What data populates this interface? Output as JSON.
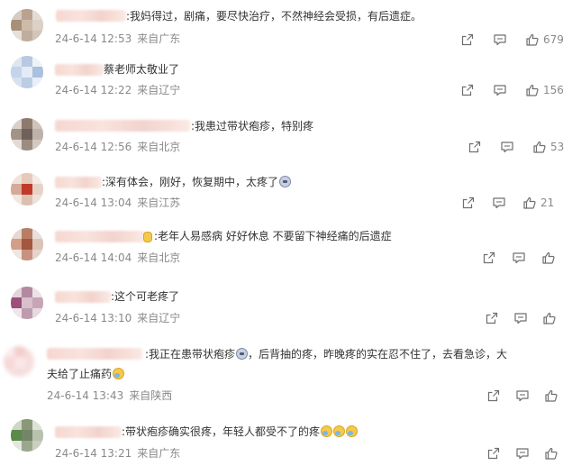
{
  "comments": [
    {
      "text_lines": [
        ":我妈得过，剧痛，要尽快治疗，不然神经会受损，有后遗症。"
      ],
      "time": "24-6-14 12:53",
      "location": "来自广东",
      "likes": "679"
    },
    {
      "text_lines": [
        "蔡老师太敬业了"
      ],
      "time": "24-6-14 12:22",
      "location": "来自辽宁",
      "likes": "156"
    },
    {
      "text_lines": [
        ":我患过带状疱疹，特别疼"
      ],
      "time": "24-6-14 12:56",
      "location": "来自北京",
      "likes": "53"
    },
    {
      "text_lines": [
        ":深有体会，刚好，恢复期中，太疼了"
      ],
      "time": "24-6-14 13:04",
      "location": "来自江苏",
      "likes": "21"
    },
    {
      "text_lines": [
        ":老年人易感病 好好休息 不要留下神经痛的后遗症"
      ],
      "time": "24-6-14 14:04",
      "location": "来自北京",
      "likes": ""
    },
    {
      "text_lines": [
        ":这个可老疼了"
      ],
      "time": "24-6-14 13:10",
      "location": "来自辽宁",
      "likes": ""
    },
    {
      "text_lines": [
        ":我正在患带状疱疹",
        "，后背抽的疼，昨晚疼的实在忍不住了，去看急诊，大",
        "夫给了止痛药"
      ],
      "time": "24-6-14 13:43",
      "location": "来自陕西",
      "likes": ""
    },
    {
      "text_lines": [
        ":带状疱疹确实很疼，年轻人都受不了的疼"
      ],
      "time": "24-6-14 13:21",
      "location": "来自广东",
      "likes": ""
    }
  ],
  "icons": {
    "share": "share-icon",
    "comment": "comment-icon",
    "like": "thumbs-up-icon"
  },
  "colors": {
    "text": "#333333",
    "meta": "#8a8a8a",
    "icon": "#6f6f6f"
  }
}
